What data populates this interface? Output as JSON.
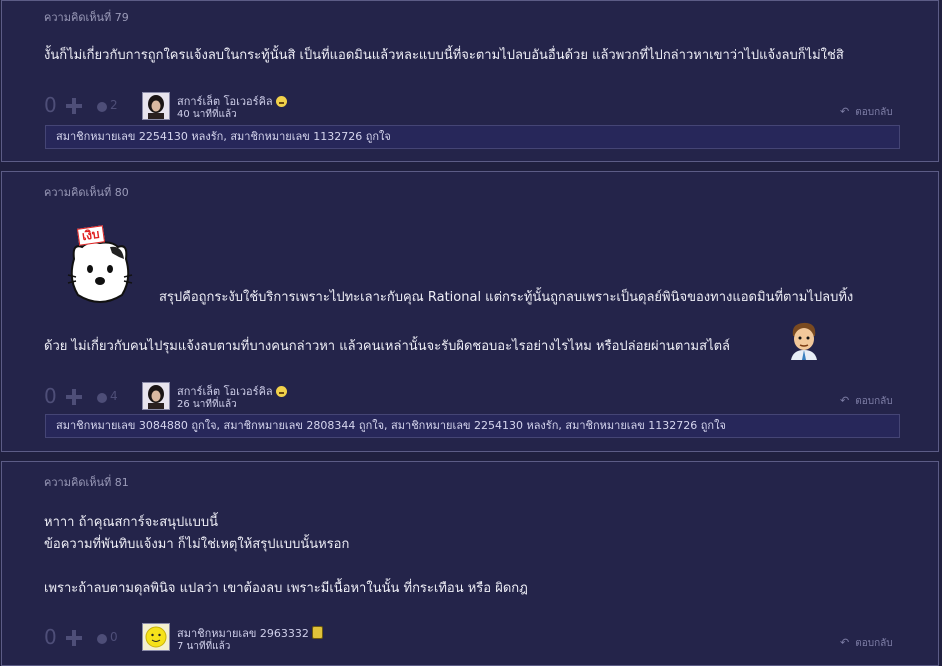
{
  "comments": [
    {
      "number_label": "ความคิดเห็นที่ 79",
      "text_lines": [
        "งั้นก็ไม่เกี่ยวกับการถูกใครแจ้งลบในกระทู้นั้นสิ เป็นที่แอดมินแล้วหละแบบนี้ที่จะตามไปลบอันอื่นด้วย แล้วพวกที่ไปกล่าวหาเขาว่าไปแจ้งลบก็ไม่ใช่สิ"
      ],
      "votes": "0",
      "emotions": "2",
      "author": "สการ์เล็ต โอเวอร์คิล",
      "time": "40 นาทีที่แล้ว",
      "reply": "ตอบกลับ",
      "likes": "สมาชิกหมายเลข 2254130 หลงรัก, สมาชิกหมายเลข 1132726 ถูกใจ"
    },
    {
      "number_label": "ความคิดเห็นที่ 80",
      "sticker_text": "เงิบ",
      "text_lines": [
        "สรุปคือถูกระงับใช้บริการเพราะไปทะเลาะกับคุณ Rational แต่กระทู้นั้นถูกลบเพราะเป็นดุลย์พินิจของทางแอดมินที่ตามไปลบทิ้ง",
        "ด้วย  ไม่เกี่ยวกับคนไปรุมแจ้งลบตามที่บางคนกล่าวหา  แล้วคนเหล่านั้นจะรับผิดชอบอะไรอย่างไรไหม หรือปล่อยผ่านตามสไตล์"
      ],
      "votes": "0",
      "emotions": "4",
      "author": "สการ์เล็ต โอเวอร์คิล",
      "time": "26 นาทีที่แล้ว",
      "reply": "ตอบกลับ",
      "likes": "สมาชิกหมายเลข 3084880 ถูกใจ, สมาชิกหมายเลข 2808344 ถูกใจ, สมาชิกหมายเลข 2254130 หลงรัก, สมาชิกหมายเลข 1132726 ถูกใจ"
    },
    {
      "number_label": "ความคิดเห็นที่ 81",
      "text_lines": [
        "หาาา ถ้าคุณสการ์จะสนุปแบบนี้",
        "ข้อความที่พันทิบแจ้งมา ก็ไม่ใช่เหตุให้สรุปแบบนั้นหรอก",
        "เพราะถ้าลบตามดุลพินิจ แปลว่า เขาต้องลบ เพราะมีเนื้อหาในนั้น ที่กระเทือน หรือ ผิดกฎ"
      ],
      "votes": "0",
      "emotions": "0",
      "author": "สมาชิกหมายเลข 2963332",
      "time": "7 นาทีที่แล้ว",
      "reply": "ตอบกลับ"
    }
  ],
  "colors": {
    "page_bg": "#20203f",
    "card_bg": "#24244a",
    "muted": "#4e4e78",
    "link": "#cfcfea"
  }
}
